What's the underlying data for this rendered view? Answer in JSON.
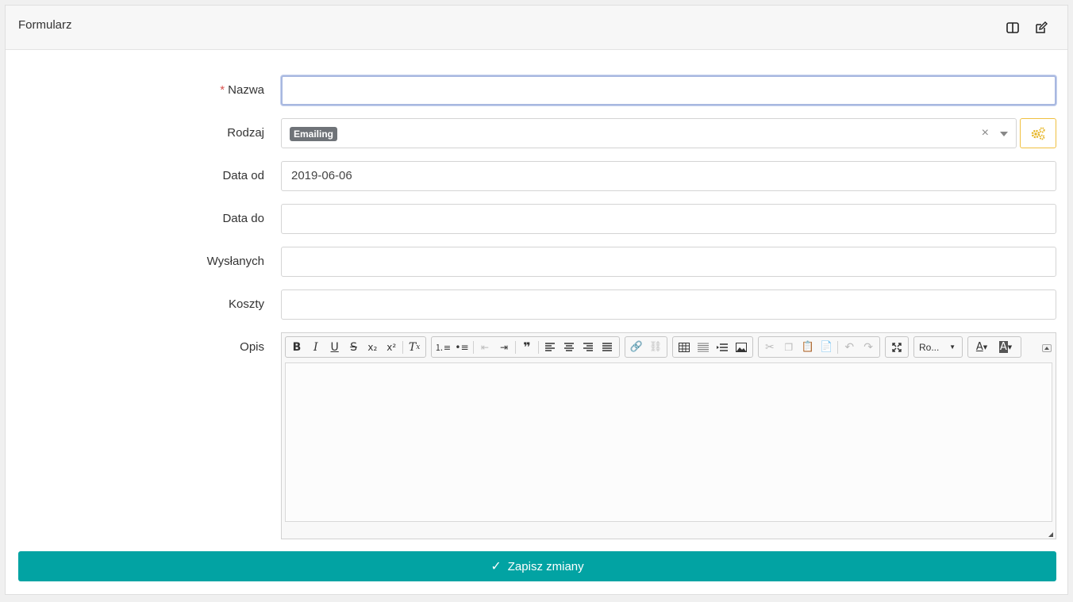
{
  "card": {
    "title": "Formularz",
    "header_icons": [
      "columns-icon",
      "edit-icon"
    ]
  },
  "form": {
    "nazwa": {
      "label": "Nazwa",
      "required_marker": "*",
      "value": ""
    },
    "rodzaj": {
      "label": "Rodzaj",
      "selected_tag": "Emailing",
      "clear_symbol": "×"
    },
    "data_od": {
      "label": "Data od",
      "value": "2019-06-06"
    },
    "data_do": {
      "label": "Data do",
      "value": ""
    },
    "wyslanych": {
      "label": "Wysłanych",
      "value": ""
    },
    "koszty": {
      "label": "Koszty",
      "value": ""
    },
    "opis": {
      "label": "Opis",
      "font_combo": "Ro...",
      "content": ""
    }
  },
  "submit": {
    "label": "Zapisz zmiany",
    "check_symbol": "✓"
  },
  "colors": {
    "submit_bg": "#02a3a3",
    "required": "#d9534f",
    "tag_bg": "#6f7378",
    "settings_border": "#f0c040"
  }
}
